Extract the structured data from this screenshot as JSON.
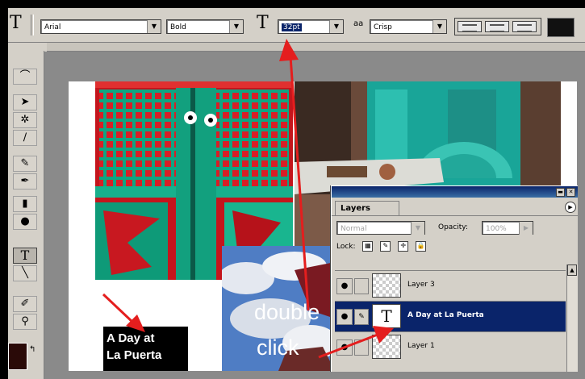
{
  "options_bar": {
    "tool_glyph": "T",
    "font_family": "Arial",
    "font_style": "Bold",
    "size_glyph": "T",
    "font_size": "32pt",
    "aa_label": "aa",
    "anti_alias": "Crisp"
  },
  "tools": {
    "type_tool_glyph": "T"
  },
  "document": {
    "text_layer_lines": [
      "A Day at",
      "La Puerta"
    ]
  },
  "annotations": {
    "line1": "double",
    "line2": "click"
  },
  "layers_panel": {
    "tab_label": "Layers",
    "blend_mode": "Normal",
    "opacity_label": "Opacity:",
    "opacity_value": "100%",
    "lock_label": "Lock:",
    "layers": [
      {
        "name": "Layer 3",
        "thumb_type": "image",
        "active": false
      },
      {
        "name": "A Day at La Puerta",
        "thumb_type": "text",
        "thumb_glyph": "T",
        "active": true
      },
      {
        "name": "Layer 1",
        "thumb_type": "image",
        "active": false
      }
    ]
  },
  "colors": {
    "arrow": "#e41e1e",
    "selection": "#0a246a",
    "foreground_swatch": "#111111"
  }
}
